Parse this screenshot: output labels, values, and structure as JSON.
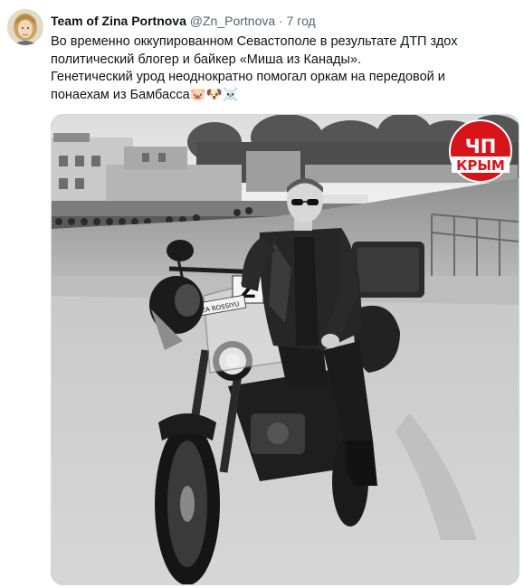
{
  "tweet": {
    "display_name": "Team of Zina Portnova",
    "handle": "@Zn_Portnova",
    "separator": "·",
    "time": "7 год",
    "line1": "Во временно оккупированном Севастополе в результате ДТП здох",
    "line2": "политический блогер и байкер «Миша из Канады».",
    "line3": "Генетический урод неоднократно помогал оркам на передовой и",
    "line4_text": "понаехам из Бамбасса",
    "line4_emoji": "🐷🐶☠️"
  },
  "media": {
    "badge_top": "ЧП",
    "badge_bottom": "КРЫМ",
    "badge_color": "#d8141b",
    "windshield_sticker": "Z",
    "front_sticker": "ZA ROSSIYU"
  },
  "icons": [
    "avatar-portrait-icon",
    "pig-emoji-icon",
    "dog-emoji-icon",
    "skull-emoji-icon"
  ]
}
